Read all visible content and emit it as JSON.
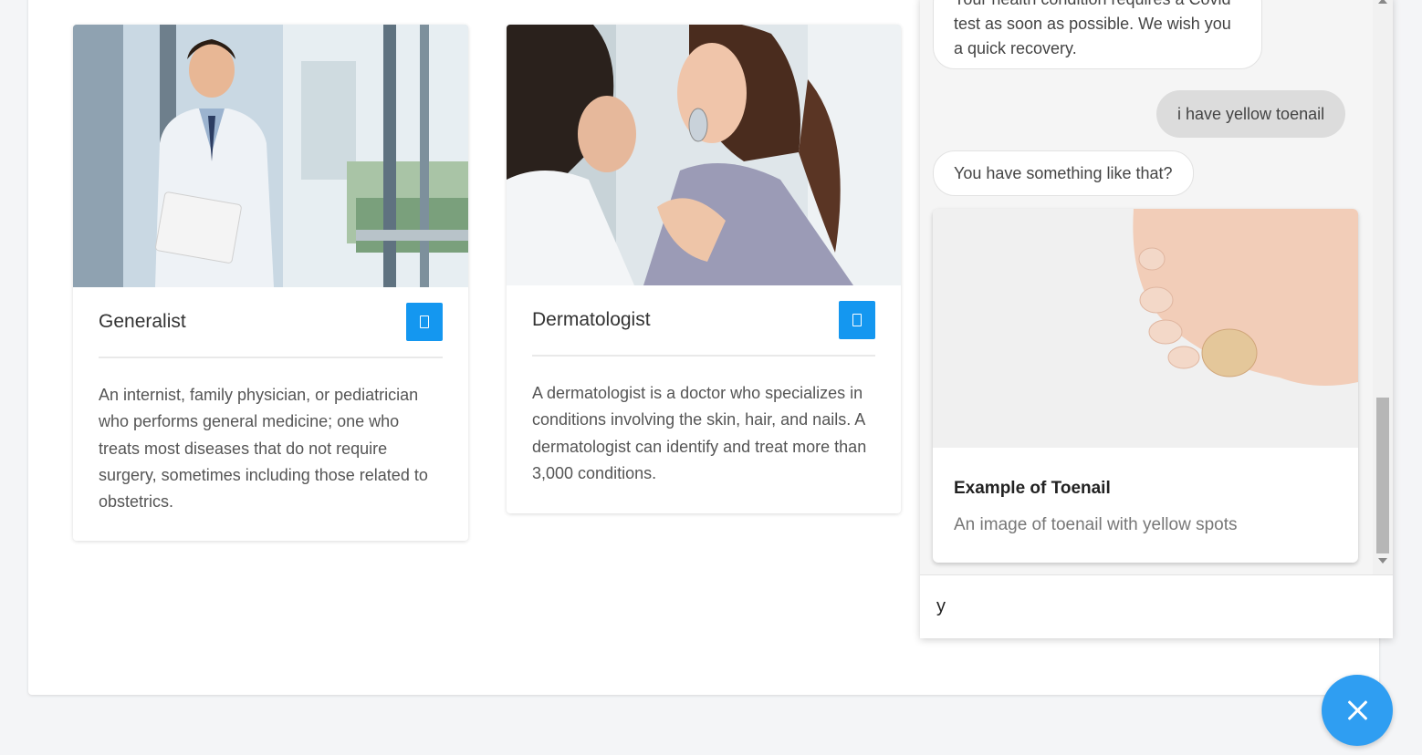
{
  "cards": [
    {
      "title": "Generalist",
      "description": "An internist, family physician, or pediatrician who performs general medicine; one who treats most diseases that do not require surgery, sometimes including those related to obstetrics.",
      "button_icon": "phone-icon"
    },
    {
      "title": "Dermatologist",
      "description": "A dermatologist is a doctor who specializes in conditions involving the skin, hair, and nails. A dermatologist can identify and treat more than 3,000 conditions.",
      "button_icon": "phone-icon"
    }
  ],
  "chat": {
    "messages": [
      {
        "from": "bot",
        "text": "Your health condition requires a Covid test as soon as possible. We wish you a quick recovery."
      },
      {
        "from": "user",
        "text": "i have yellow toenail"
      },
      {
        "from": "bot",
        "text": "You have something like that?"
      }
    ],
    "media_card": {
      "title": "Example of Toenail",
      "subtitle": "An image of toenail with yellow spots"
    },
    "input_value": "y"
  },
  "colors": {
    "accent": "#1497f0",
    "fab": "#2f9ef2",
    "user_bubble": "#dcdcdc"
  },
  "fab_icon": "close-icon"
}
